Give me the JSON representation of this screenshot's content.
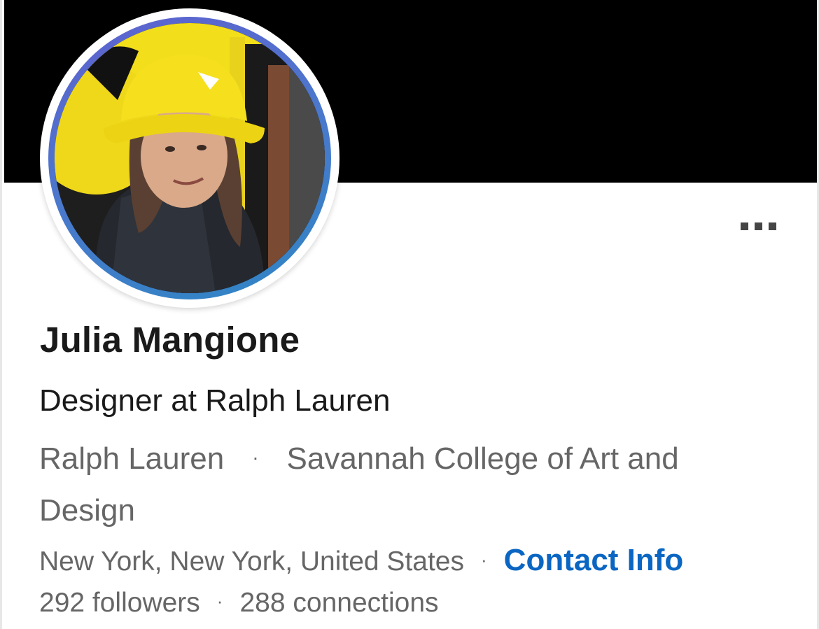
{
  "profile": {
    "name": "Julia Mangione",
    "headline": "Designer at Ralph Lauren",
    "company": "Ralph Lauren",
    "school": "Savannah College of Art and Design",
    "location": "New York, New York, United States",
    "contact_info_label": "Contact Info",
    "followers": "292 followers",
    "connections": "288 connections",
    "separator": "·"
  },
  "more_button": {
    "icon": "more-horizontal-icon"
  },
  "colors": {
    "cover": "#000000",
    "link": "#0a66c2",
    "avatar_ring_start": "#6060d0",
    "avatar_ring_end": "#2e86c4",
    "secondary_text": "#666666",
    "primary_text": "#1a1a1a"
  }
}
